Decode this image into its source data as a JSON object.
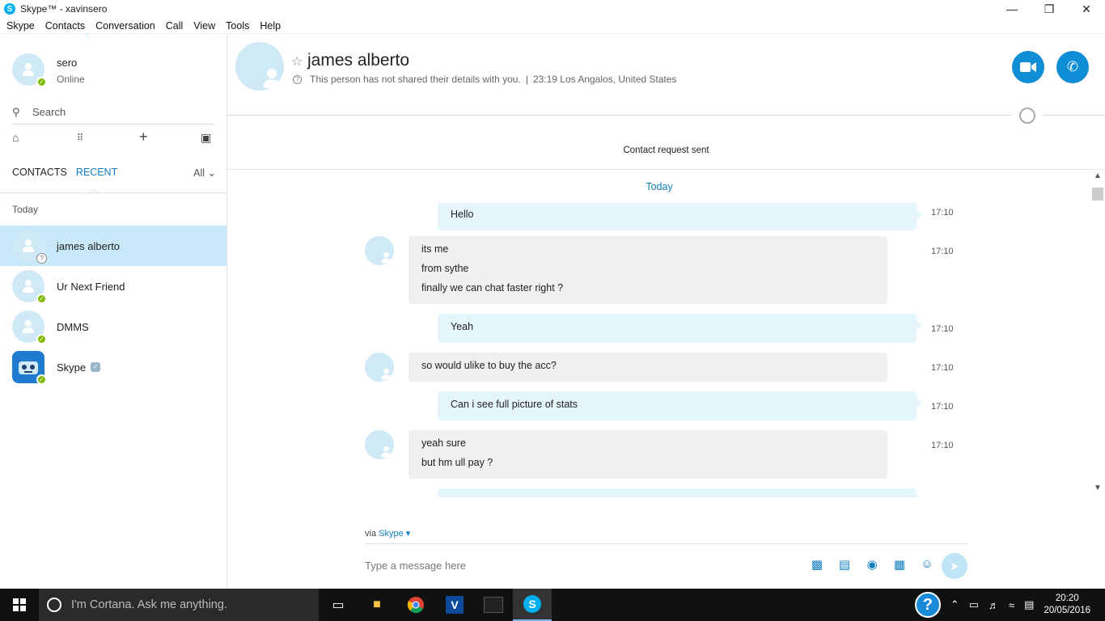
{
  "window": {
    "title": "Skype™ - xavinsero",
    "app_icon": "S",
    "minimize": "—",
    "restore": "❐",
    "close": "✕"
  },
  "menu": [
    "Skype",
    "Contacts",
    "Conversation",
    "Call",
    "View",
    "Tools",
    "Help"
  ],
  "profile": {
    "name": "sero",
    "status": "Online"
  },
  "search": {
    "label": "Search"
  },
  "tabs": {
    "contacts": "CONTACTS",
    "recent": "RECENT",
    "filter": "All ⌄"
  },
  "recent_group": "Today",
  "contacts": [
    {
      "name": "james alberto",
      "status": "pending",
      "active": true
    },
    {
      "name": "Ur Next Friend",
      "status": "online"
    },
    {
      "name": "DMMS",
      "status": "online"
    },
    {
      "name": "Skype",
      "status": "online",
      "bot": true,
      "verified": true
    }
  ],
  "conversation": {
    "name": "james alberto",
    "info": "This person has not shared their details with you.",
    "separator": "|",
    "local_time": "23:19 Los Angalos, United States",
    "request_sent": "Contact request sent",
    "day_label": "Today"
  },
  "messages": [
    {
      "dir": "out",
      "lines": [
        "Hello"
      ],
      "time": "17:10"
    },
    {
      "dir": "in",
      "lines": [
        "its me",
        "from sythe",
        "finally we can chat faster right ?"
      ],
      "time": "17:10"
    },
    {
      "dir": "out",
      "lines": [
        "Yeah"
      ],
      "time": "17:10"
    },
    {
      "dir": "in",
      "lines": [
        "so would ulike to buy the acc?"
      ],
      "time": "17:10"
    },
    {
      "dir": "out",
      "lines": [
        "Can i see full picture of stats"
      ],
      "time": "17:10"
    },
    {
      "dir": "in",
      "lines": [
        "yeah sure",
        "but hm ull pay ?"
      ],
      "time": "17:10"
    }
  ],
  "compose": {
    "via_prefix": "via",
    "via_service": "Skype ▾",
    "placeholder": "Type a message here"
  },
  "taskbar": {
    "cortana": "I'm Cortana. Ask me anything.",
    "time": "20:20",
    "date": "20/05/2016",
    "help": "?"
  },
  "colors": {
    "accent": "#0f8ed6",
    "online": "#7fba00",
    "selected": "#c7e9f9",
    "outgoing": "#e4f5fc",
    "incoming": "#eef0f2"
  },
  "icons": [
    "home-icon",
    "dialpad-icon",
    "add-icon",
    "bot-icon",
    "video-call-icon",
    "audio-call-icon",
    "globe-icon",
    "photo-icon",
    "file-icon",
    "video-message-icon",
    "contact-card-icon",
    "emoticon-icon",
    "send-icon"
  ]
}
